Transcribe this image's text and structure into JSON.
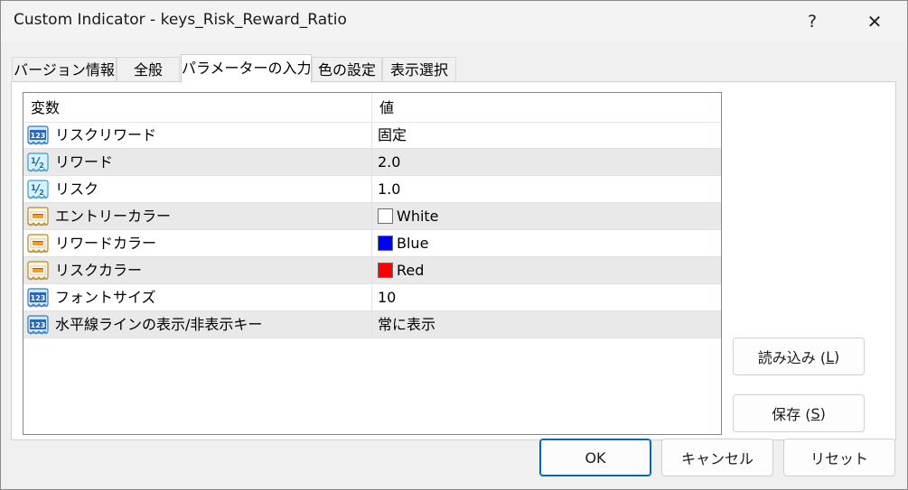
{
  "window": {
    "title": "Custom Indicator - keys_Risk_Reward_Ratio",
    "help_label": "?",
    "close_label": "✕"
  },
  "tabs": [
    {
      "label": "バージョン情報",
      "active": false
    },
    {
      "label": "全般",
      "active": false
    },
    {
      "label": "パラメーターの入力",
      "active": true
    },
    {
      "label": "色の設定",
      "active": false
    },
    {
      "label": "表示選択",
      "active": false
    }
  ],
  "grid": {
    "columns": [
      "変数",
      "値"
    ],
    "rows": [
      {
        "icon": "int-icon",
        "label": "リスクリワード",
        "value": "固定"
      },
      {
        "icon": "double-icon",
        "label": "リワード",
        "value": "2.0"
      },
      {
        "icon": "double-icon",
        "label": "リスク",
        "value": "1.0"
      },
      {
        "icon": "color-icon",
        "label": "エントリーカラー",
        "value": "White",
        "swatch": "#ffffff"
      },
      {
        "icon": "color-icon",
        "label": "リワードカラー",
        "value": "Blue",
        "swatch": "#0000ff"
      },
      {
        "icon": "color-icon",
        "label": "リスクカラー",
        "value": "Red",
        "swatch": "#ff0000"
      },
      {
        "icon": "int-icon",
        "label": "フォントサイズ",
        "value": "10"
      },
      {
        "icon": "int-icon",
        "label": "水平線ラインの表示/非表示キー",
        "value": "常に表示"
      }
    ]
  },
  "side_buttons": {
    "load_label": "読み込み (",
    "load_key": "L",
    "load_end": ")",
    "save_label": "保存 (",
    "save_key": "S",
    "save_end": ")"
  },
  "footer": {
    "ok_label": "OK",
    "cancel_label": "キャンセル",
    "reset_label": "リセット"
  },
  "colors": {
    "accent": "#0067c0",
    "alt_row": "#e9e9e9"
  }
}
